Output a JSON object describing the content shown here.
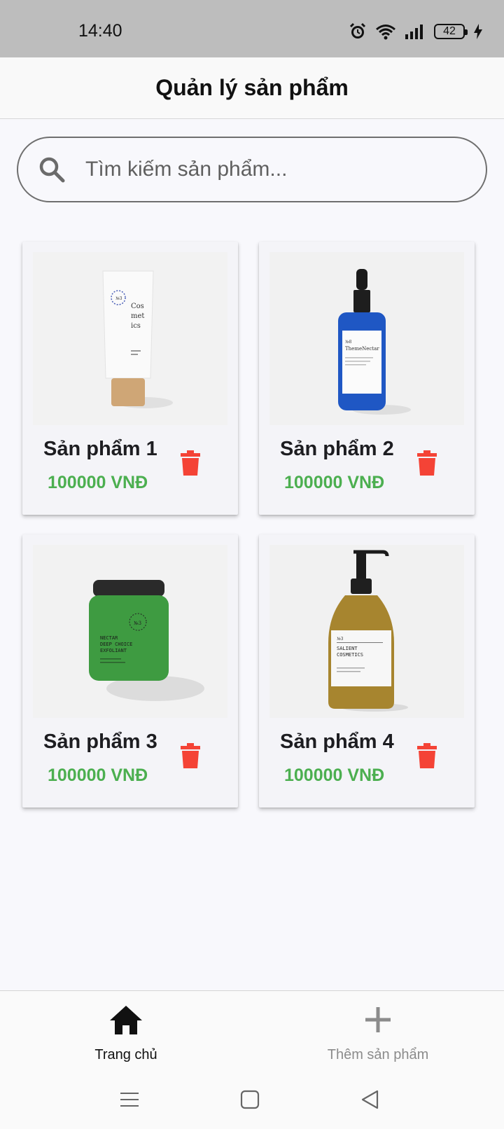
{
  "status_bar": {
    "time": "14:40",
    "battery": "42",
    "icons": [
      "alarm-icon",
      "wifi-icon",
      "signal-icon",
      "battery-icon",
      "charging-icon"
    ]
  },
  "header": {
    "title": "Quản lý sản phẩm"
  },
  "search": {
    "placeholder": "Tìm kiếm sản phẩm...",
    "value": ""
  },
  "products": [
    {
      "name": "Sản phẩm 1",
      "price": "100000 VNĐ",
      "image": "cosmetic-tube"
    },
    {
      "name": "Sản phẩm 2",
      "price": "100000 VNĐ",
      "image": "blue-dropper-bottle"
    },
    {
      "name": "Sản phẩm 3",
      "price": "100000 VNĐ",
      "image": "green-jar"
    },
    {
      "name": "Sản phẩm 4",
      "price": "100000 VNĐ",
      "image": "amber-pump-bottle"
    }
  ],
  "bottom_nav": {
    "items": [
      {
        "label": "Trang chủ",
        "icon": "home-icon",
        "active": true
      },
      {
        "label": "Thêm sản phẩm",
        "icon": "plus-icon",
        "active": false
      }
    ]
  },
  "colors": {
    "price": "#4caf50",
    "delete": "#f44336",
    "status_bar": "#bdbdbd",
    "background": "#f8f8fc"
  }
}
